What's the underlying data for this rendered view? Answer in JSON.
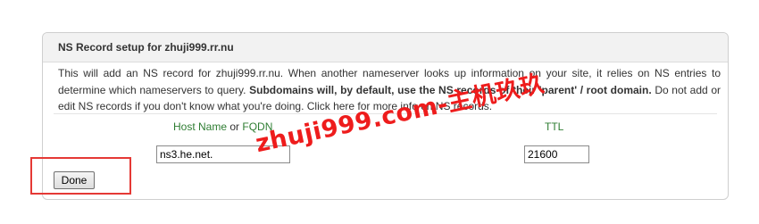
{
  "panel": {
    "title": "NS Record setup for zhuji999.rr.nu",
    "description": {
      "part1": "This will add an NS record for zhuji999.rr.nu. When another nameserver looks up information on your site, it relies on NS entries to determine which nameservers to query. ",
      "bold": "Subdomains will, by default, use the NS records of their 'parent' / root domain.",
      "part2": " Do not add or edit NS records if you don't know what you're doing. Click here for more info on NS records."
    }
  },
  "form": {
    "host_label_a": "Host Name",
    "host_label_or": " or ",
    "host_label_b": "FQDN",
    "ttl_label": "TTL",
    "host_value": "ns3.he.net.",
    "ttl_value": "21600",
    "done_label": "Done"
  },
  "overlay": {
    "watermark": "zhuji999.com-主机玖玖",
    "highlight_color": "#e53935",
    "watermark_color": "#ee1c1c"
  },
  "colors": {
    "label_green": "#2e7d32",
    "header_bg": "#f2f2f2"
  }
}
